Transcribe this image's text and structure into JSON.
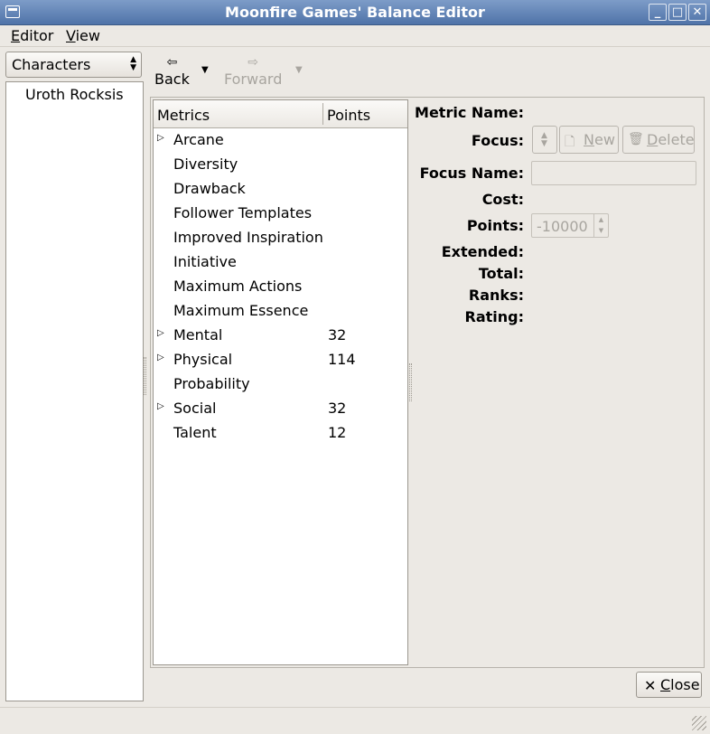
{
  "window": {
    "title": "Moonfire Games' Balance Editor",
    "controls": {
      "minimize": "_",
      "maximize": "□",
      "close": "✕"
    }
  },
  "menu": {
    "editor": {
      "mnemonic": "E",
      "rest": "ditor"
    },
    "view": {
      "mnemonic": "V",
      "rest": "iew"
    }
  },
  "category_selector": {
    "value": "Characters"
  },
  "characters": [
    "Uroth Rocksis"
  ],
  "toolbar": {
    "back_label": "Back",
    "forward_label": "Forward",
    "back_icon": "arrow-left-icon",
    "forward_icon": "arrow-right-icon"
  },
  "metrics_tree": {
    "columns": [
      "Metrics",
      "Points"
    ],
    "rows": [
      {
        "name": "Arcane",
        "points": "",
        "expandable": true
      },
      {
        "name": "Diversity",
        "points": "",
        "expandable": false
      },
      {
        "name": "Drawback",
        "points": "",
        "expandable": false
      },
      {
        "name": "Follower Templates",
        "points": "",
        "expandable": false
      },
      {
        "name": "Improved Inspiration",
        "points": "",
        "expandable": false
      },
      {
        "name": "Initiative",
        "points": "",
        "expandable": false
      },
      {
        "name": "Maximum Actions",
        "points": "",
        "expandable": false
      },
      {
        "name": "Maximum Essence",
        "points": "",
        "expandable": false
      },
      {
        "name": "Mental",
        "points": "32",
        "expandable": true
      },
      {
        "name": "Physical",
        "points": "114",
        "expandable": true
      },
      {
        "name": "Probability",
        "points": "",
        "expandable": false
      },
      {
        "name": "Social",
        "points": "32",
        "expandable": true
      },
      {
        "name": "Talent",
        "points": "12",
        "expandable": false
      }
    ]
  },
  "details": {
    "metric_name_label": "Metric Name:",
    "focus_label": "Focus:",
    "new_button": {
      "mnemonic": "N",
      "rest": "ew"
    },
    "delete_button": {
      "mnemonic": "D",
      "rest": "elete"
    },
    "focus_name_label": "Focus Name:",
    "focus_name_value": "",
    "cost_label": "Cost:",
    "points_label": "Points:",
    "points_value": "-10000",
    "extended_label": "Extended:",
    "total_label": "Total:",
    "ranks_label": "Ranks:",
    "rating_label": "Rating:"
  },
  "close_button": {
    "mnemonic": "C",
    "rest": "lose"
  },
  "colors": {
    "titlebar_top": "#7d9cc8",
    "titlebar_bottom": "#4f73a8",
    "window_bg": "#ece9e4",
    "disabled_text": "#a8a59f"
  }
}
